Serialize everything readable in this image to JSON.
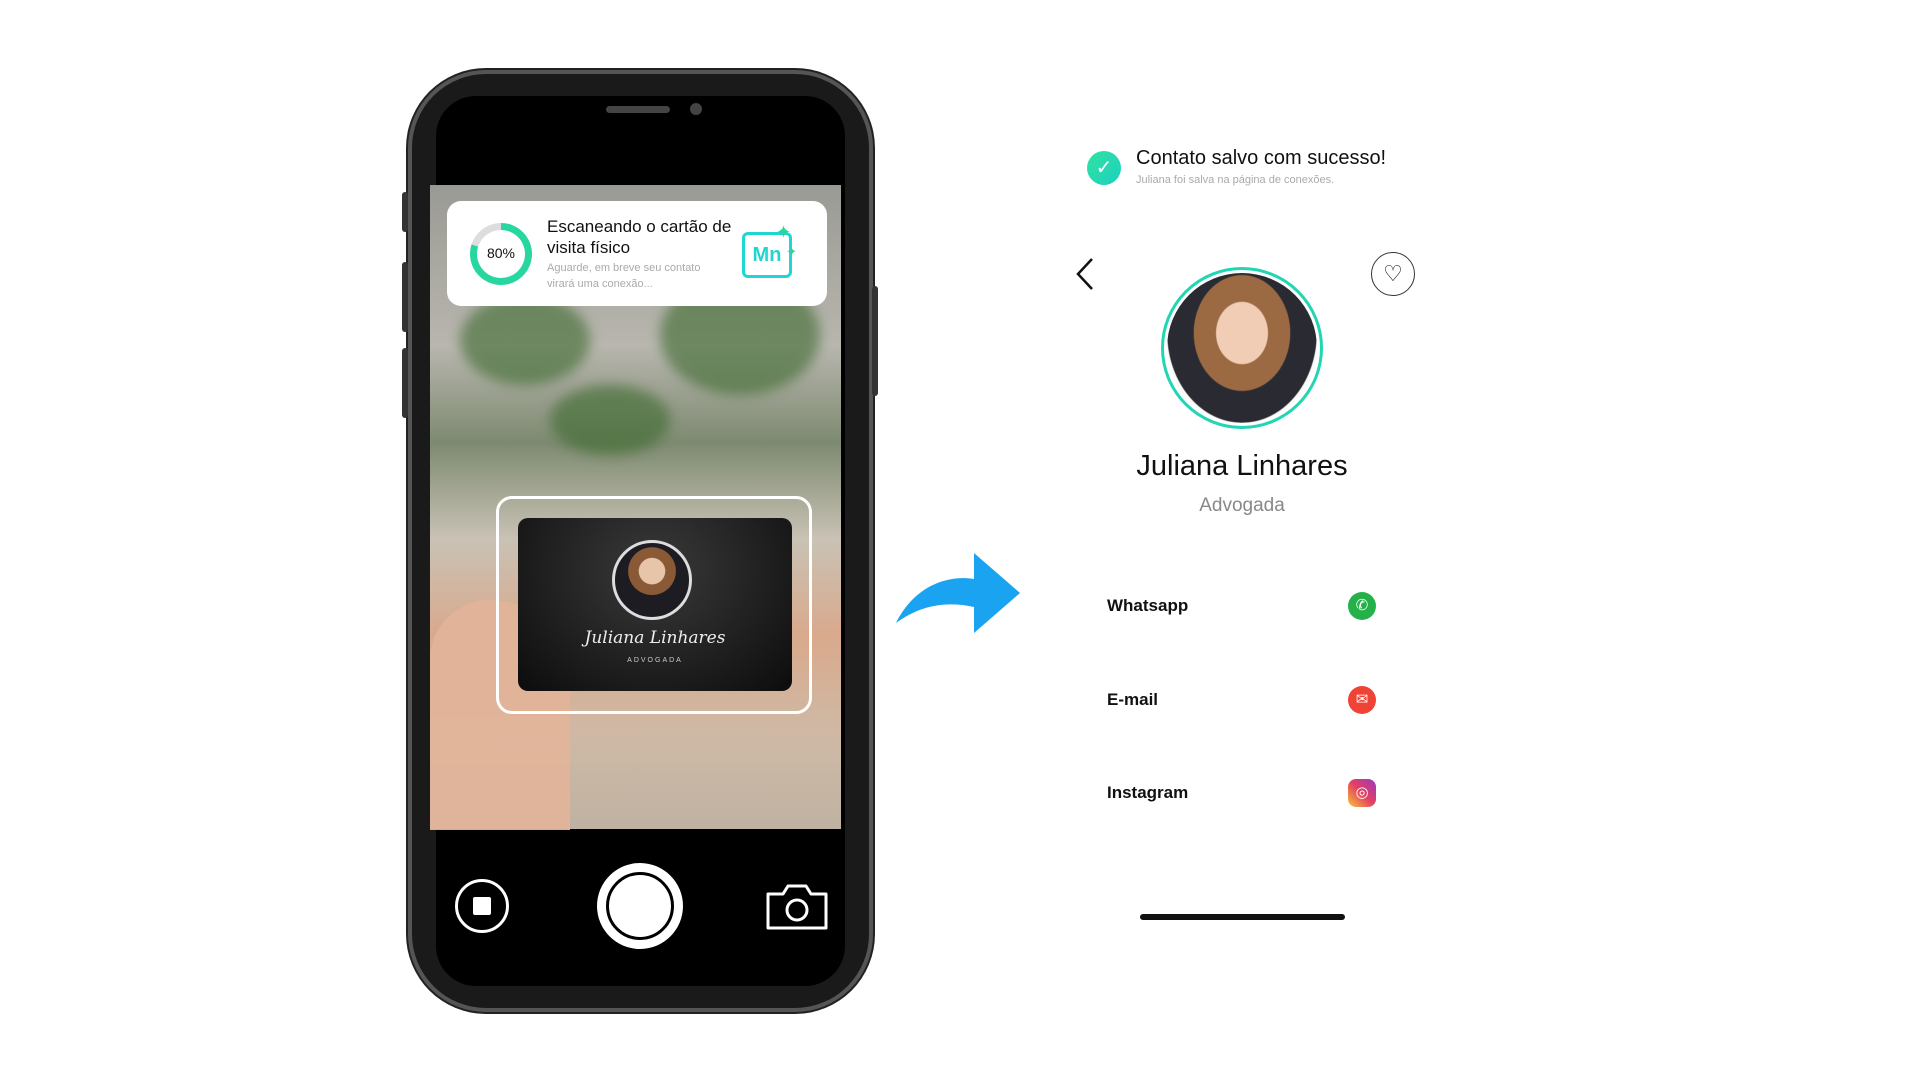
{
  "scanner": {
    "progress_label": "80%",
    "progress": 0.8,
    "title": "Escaneando o cartão de visita físico",
    "subtitle": "Aguarde, em breve seu contato virará uma conexão...",
    "logo_text": "Mn",
    "card": {
      "name": "Juliana Linhares",
      "title": "ADVOGADA"
    }
  },
  "camera_controls": {
    "stop": "stop-icon",
    "shutter": "shutter-button",
    "switch": "camera-icon"
  },
  "toast": {
    "title": "Contato salvo com sucesso!",
    "subtitle": "Juliana foi salva na página de conexões."
  },
  "profile": {
    "name": "Juliana Linhares",
    "role": "Advogada",
    "contacts": [
      {
        "label": "Whatsapp",
        "icon": "whatsapp-icon",
        "color": "#25b14a"
      },
      {
        "label": "E-mail",
        "icon": "email-icon",
        "color": "#ee4335"
      },
      {
        "label": "Instagram",
        "icon": "instagram-icon",
        "color": "#d6287a"
      }
    ]
  },
  "colors": {
    "accent": "#22d6b4",
    "arrow": "#1aa3f0"
  }
}
